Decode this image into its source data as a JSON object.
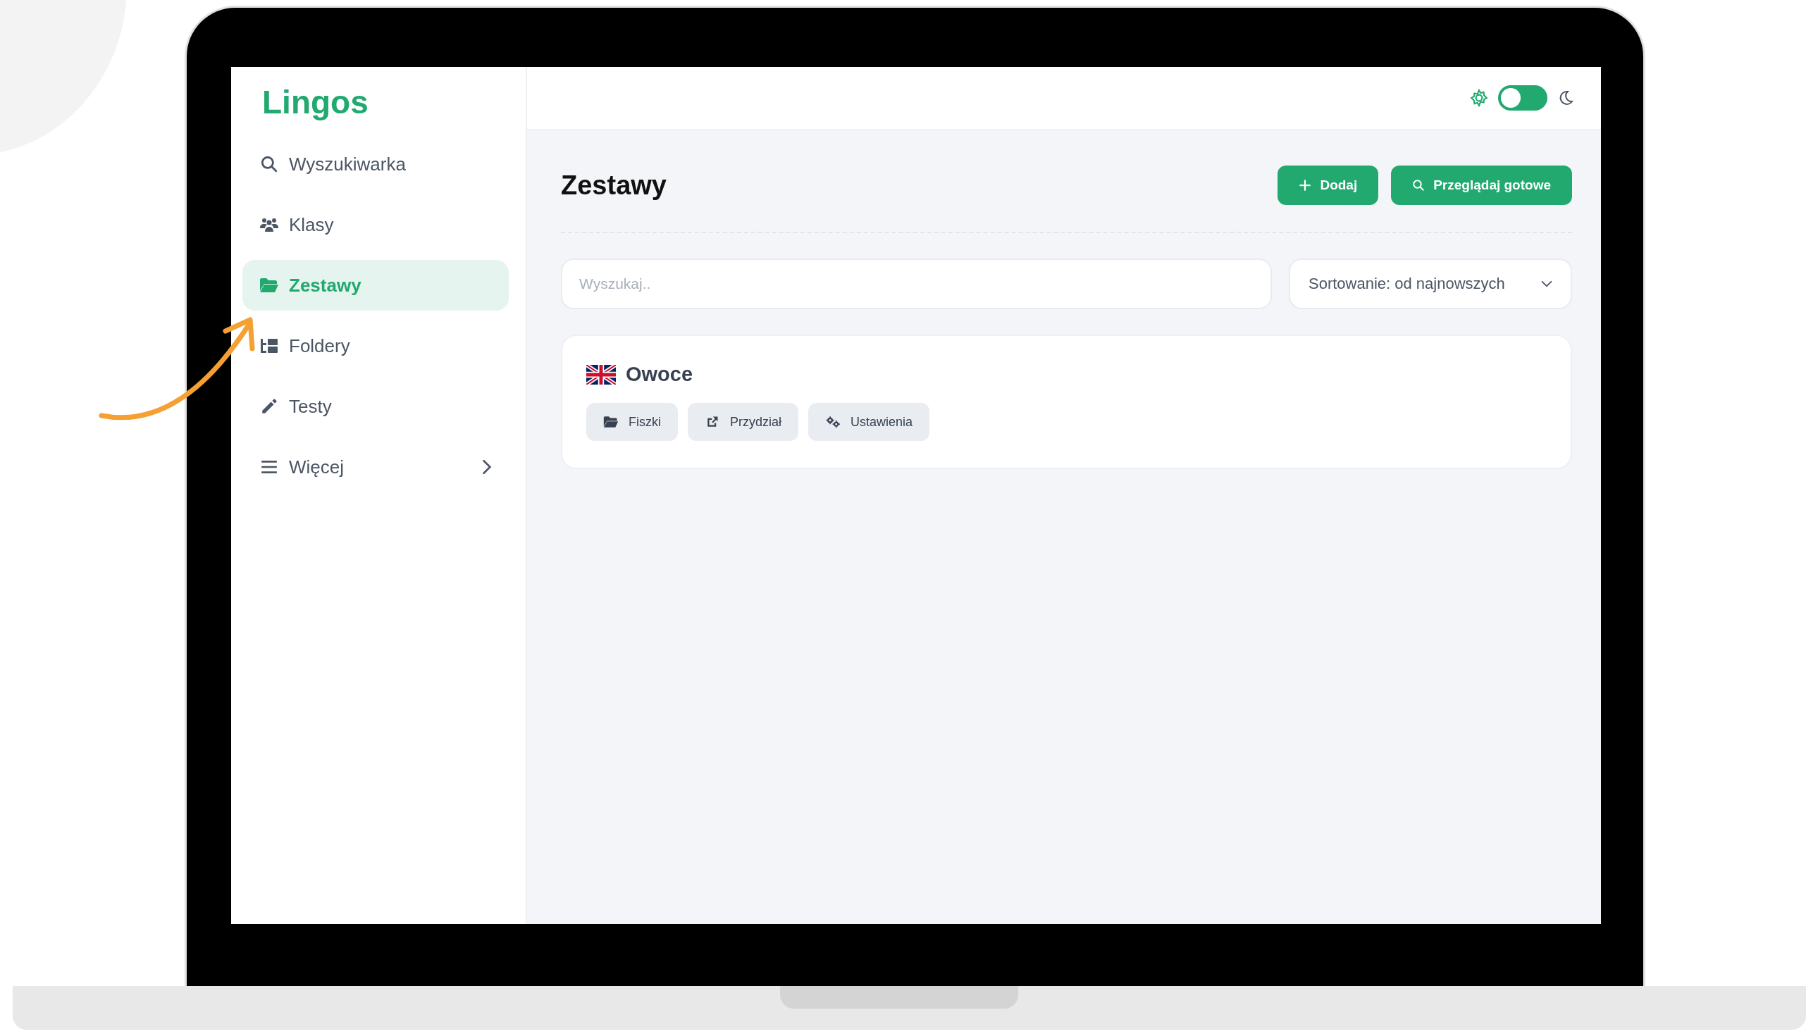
{
  "app": {
    "logo": "Lingos"
  },
  "sidebar": {
    "items": [
      {
        "kind": "search",
        "label": "Wyszukiwarka",
        "selected": false,
        "has_submenu": false
      },
      {
        "kind": "users",
        "label": "Klasy",
        "selected": false,
        "has_submenu": false
      },
      {
        "kind": "folder",
        "label": "Zestawy",
        "selected": true,
        "has_submenu": false
      },
      {
        "kind": "tree",
        "label": "Foldery",
        "selected": false,
        "has_submenu": false
      },
      {
        "kind": "pencil",
        "label": "Testy",
        "selected": false,
        "has_submenu": false
      },
      {
        "kind": "menu",
        "label": "Więcej",
        "selected": false,
        "has_submenu": true
      }
    ]
  },
  "header": {
    "dark_mode": false
  },
  "page": {
    "title": "Zestawy",
    "buttons": [
      {
        "kind": "plus",
        "label": "Dodaj"
      },
      {
        "kind": "search",
        "label": "Przeglądaj gotowe"
      }
    ],
    "search": {
      "placeholder": "Wyszukaj.."
    },
    "sort": {
      "value": "Sortowanie: od najnowszych"
    },
    "sets": [
      {
        "title": "Owoce",
        "actions": [
          {
            "kind": "folder",
            "label": "Fiszki"
          },
          {
            "kind": "share",
            "label": "Przydział"
          },
          {
            "kind": "gears",
            "label": "Ustawienia"
          }
        ]
      }
    ]
  }
}
